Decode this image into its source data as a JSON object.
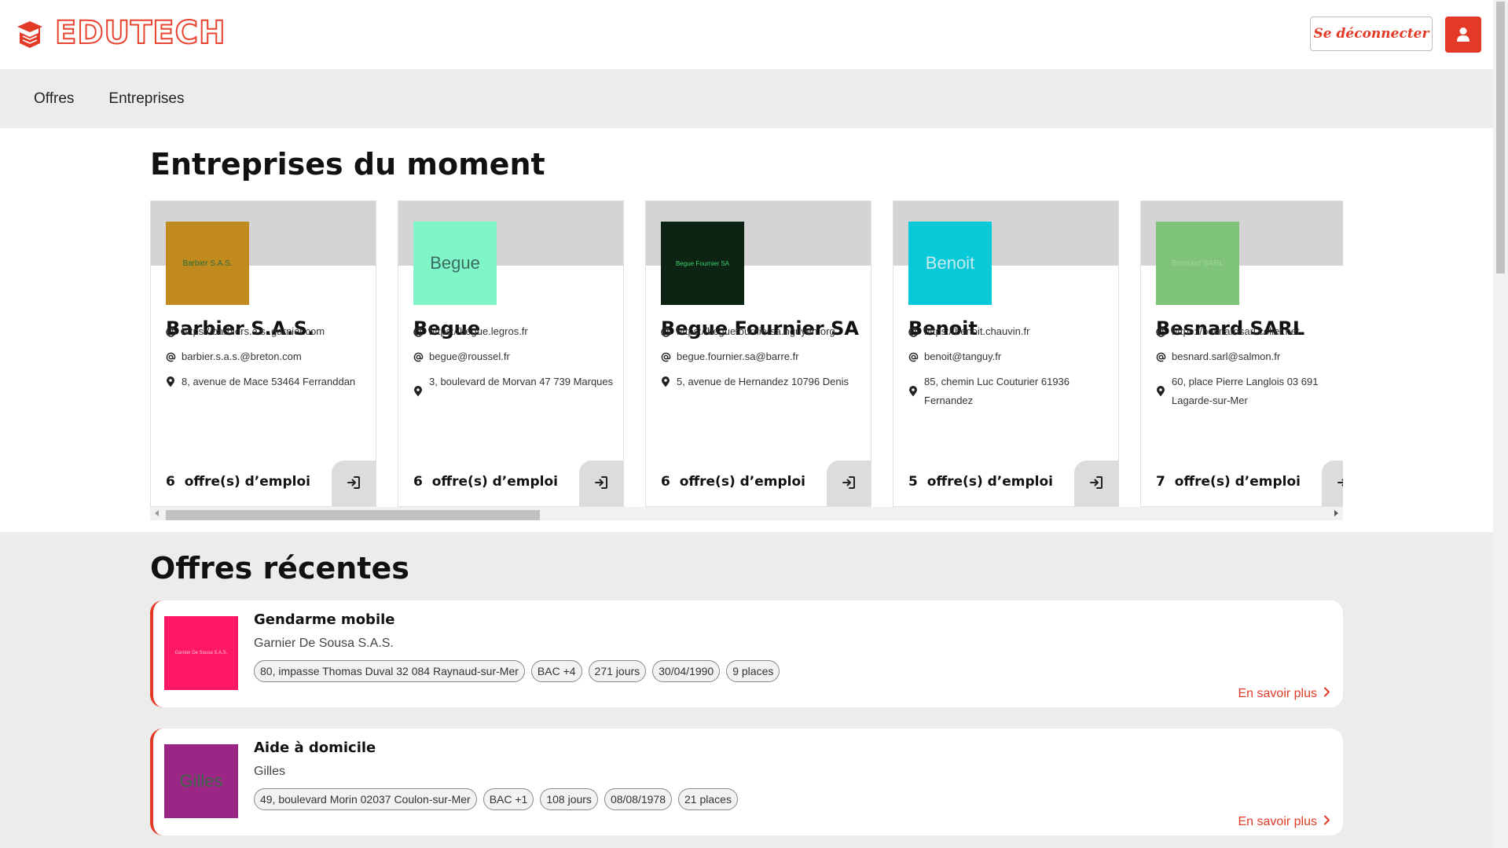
{
  "header": {
    "brand": "EDUTECH",
    "logo_icon": "graduation-cap-box-icon",
    "logout_label": "Se déconnecter",
    "user_icon": "user-icon",
    "accent_color": "#e23a26"
  },
  "nav": {
    "items": [
      {
        "label": "Offres"
      },
      {
        "label": "Entreprises"
      }
    ]
  },
  "companies": {
    "title": "Entreprises du moment",
    "cards": [
      {
        "name": "Barbier S.A.S.",
        "logo_text": "Barbier S.A.S.",
        "logo_bg": "#c08a1e",
        "logo_fg": "#2a6b3a",
        "website": "https://barbiers.a.s..garnier.com",
        "email": "barbier.s.a.s.@breton.com",
        "address": "8, avenue de Mace 53464 Ferranddan",
        "offers_count": "6",
        "offers_label": "offre(s) d’emploi"
      },
      {
        "name": "Begue",
        "logo_text": "Begue",
        "logo_bg": "#7ff5c8",
        "logo_fg": "#3a6b60",
        "website": "https://begue.legros.fr",
        "email": "begue@roussel.fr",
        "address": "3, boulevard de Morvan 47 739 Marques",
        "offers_count": "6",
        "offers_label": "offre(s) d’emploi"
      },
      {
        "name": "Begue Fournier SA",
        "logo_text": "Begue Fournier SA",
        "logo_bg": "#0d2414",
        "logo_fg": "#3bd16a",
        "website": "https://beguefourniersa.nguyen.org",
        "email": "begue.fournier.sa@barre.fr",
        "address": "5, avenue de Hernandez 10796 Denis",
        "offers_count": "6",
        "offers_label": "offre(s) d’emploi"
      },
      {
        "name": "Benoit",
        "logo_text": "Benoit",
        "logo_bg": "#08c9d8",
        "logo_fg": "#c9e9ee",
        "website": "https://benoit.chauvin.fr",
        "email": "benoit@tanguy.fr",
        "address": "85, chemin Luc Couturier 61936 Fernandez",
        "offers_count": "5",
        "offers_label": "offre(s) d’emploi"
      },
      {
        "name": "Besnard SARL",
        "logo_text": "Besnard SARL",
        "logo_bg": "#7fc47a",
        "logo_fg": "#9fd29a",
        "website": "https://besnardsarl.collet.net",
        "email": "besnard.sarl@salmon.fr",
        "address": "60, place Pierre Langlois 03 691 Lagarde-sur-Mer",
        "offers_count": "7",
        "offers_label": "offre(s) d’emploi"
      }
    ]
  },
  "offers": {
    "title": "Offres récentes",
    "more_label": "En savoir plus",
    "items": [
      {
        "title": "Gendarme mobile",
        "company": "Garnier De Sousa S.A.S.",
        "logo_text": "Garnier De Sousa S.A.S.",
        "logo_bg": "#ff1767",
        "logo_fg": "#ffc0d6",
        "tags": [
          "80, impasse Thomas Duval 32 084 Raynaud-sur-Mer",
          "BAC +4",
          "271  jours",
          "30/04/1990",
          "9 places"
        ]
      },
      {
        "title": "Aide à domicile",
        "company": "Gilles",
        "logo_text": "Gilles",
        "logo_bg": "#9b2685",
        "logo_fg": "#3d6a4a",
        "tags": [
          "49, boulevard Morin 02037 Coulon-sur-Mer",
          "BAC +1",
          "108  jours",
          "08/08/1978",
          "21 places"
        ]
      }
    ]
  }
}
